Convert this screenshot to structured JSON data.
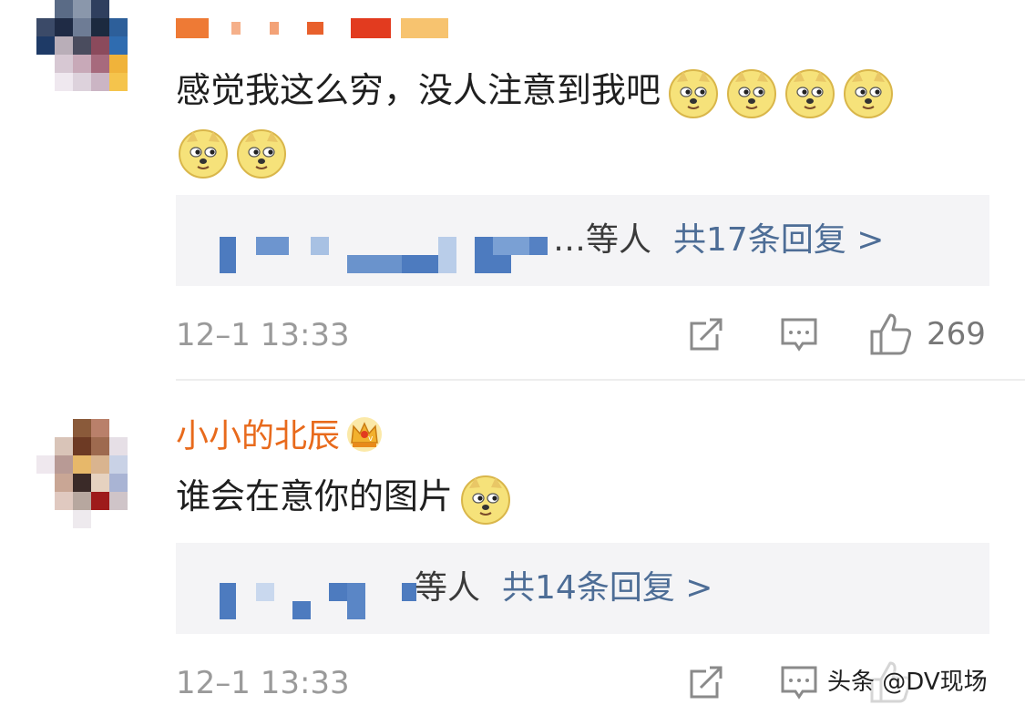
{
  "comments": [
    {
      "username": "",
      "text": "感觉我这么穷，没人注意到我吧",
      "emoji_icon": "doge-emoji",
      "emoji_count": 6,
      "reply_suffix": "…等人",
      "reply_count_label": "共17条回复 >",
      "timestamp": "12–1 13:33",
      "like_count": "269"
    },
    {
      "username": "小小的北辰",
      "badge_icon": "crown-icon",
      "text": "谁会在意你的图片",
      "emoji_icon": "doge-emoji",
      "emoji_count": 1,
      "reply_suffix": "等人",
      "reply_count_label": "共14条回复 >",
      "timestamp": "12–1 13:33",
      "like_count": ""
    }
  ],
  "watermark": "头条 @DV现场",
  "colors": {
    "username": "#e86a1c",
    "link": "#4d6d96",
    "reply_bg": "#f4f4f6",
    "timestamp": "#9a9a9a"
  }
}
